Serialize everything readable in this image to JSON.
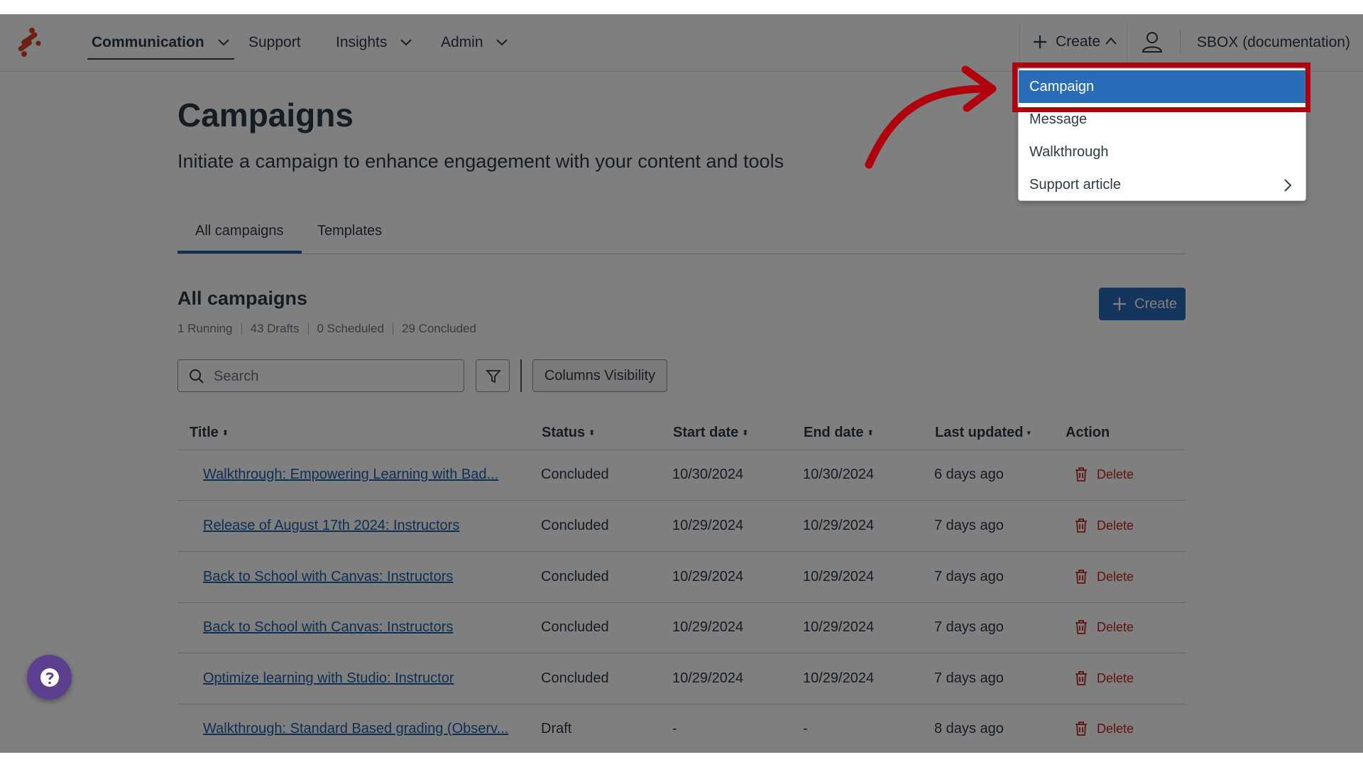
{
  "nav": {
    "items": [
      {
        "label": "Communication",
        "has_chevron": true,
        "active": true
      },
      {
        "label": "Support",
        "has_chevron": false
      },
      {
        "label": "Insights",
        "has_chevron": true
      },
      {
        "label": "Admin",
        "has_chevron": true
      }
    ],
    "create_label": "Create",
    "account_label": "SBOX (documentation)"
  },
  "page": {
    "title": "Campaigns",
    "subtitle": "Initiate a campaign to enhance engagement with your content and tools",
    "tabs": [
      {
        "label": "All campaigns",
        "active": true
      },
      {
        "label": "Templates",
        "active": false
      }
    ]
  },
  "section": {
    "title": "All campaigns",
    "stats": [
      "1 Running",
      "43 Drafts",
      "0 Scheduled",
      "29 Concluded"
    ],
    "create_label": "Create"
  },
  "toolbar": {
    "search_placeholder": "Search",
    "columns_visibility_label": "Columns Visibility"
  },
  "table": {
    "columns": [
      {
        "label": "Title",
        "sort": "⬍"
      },
      {
        "label": "Status",
        "sort": "⬍"
      },
      {
        "label": "Start date",
        "sort": "⬍"
      },
      {
        "label": "End date",
        "sort": "⬍"
      },
      {
        "label": "Last updated",
        "sort": "▾"
      },
      {
        "label": "Action",
        "sort": ""
      }
    ],
    "rows": [
      {
        "title": "Walkthrough: Empowering Learning with Bad...",
        "status": "Concluded",
        "start": "10/30/2024",
        "end": "10/30/2024",
        "updated": "6 days ago",
        "action": "Delete"
      },
      {
        "title": "Release of August 17th 2024: Instructors",
        "status": "Concluded",
        "start": "10/29/2024",
        "end": "10/29/2024",
        "updated": "7 days ago",
        "action": "Delete"
      },
      {
        "title": "Back to School with Canvas: Instructors",
        "status": "Concluded",
        "start": "10/29/2024",
        "end": "10/29/2024",
        "updated": "7 days ago",
        "action": "Delete"
      },
      {
        "title": "Back to School with Canvas: Instructors",
        "status": "Concluded",
        "start": "10/29/2024",
        "end": "10/29/2024",
        "updated": "7 days ago",
        "action": "Delete"
      },
      {
        "title": "Optimize learning with Studio: Instructor",
        "status": "Concluded",
        "start": "10/29/2024",
        "end": "10/29/2024",
        "updated": "7 days ago",
        "action": "Delete"
      },
      {
        "title": "Walkthrough: Standard Based grading (Observ...",
        "status": "Draft",
        "start": "-",
        "end": "-",
        "updated": "8 days ago",
        "action": "Delete"
      }
    ]
  },
  "create_menu": {
    "items": [
      {
        "label": "Campaign",
        "selected": true
      },
      {
        "label": "Message",
        "selected": false
      },
      {
        "label": "Walkthrough",
        "selected": false
      },
      {
        "label": "Support article",
        "selected": false,
        "submenu": true
      }
    ]
  },
  "colors": {
    "primary": "#2b6cb8",
    "link": "#1e5ea8",
    "danger": "#c0261e",
    "highlight": "#b0000e",
    "text": "#2d3b45",
    "help_button": "#5c3f8f"
  },
  "icons": [
    "logo-icon",
    "chevron-down-icon",
    "plus-icon",
    "chevron-up-icon",
    "user-icon",
    "search-icon",
    "filter-icon",
    "trash-icon",
    "chevron-right-icon",
    "question-icon"
  ]
}
